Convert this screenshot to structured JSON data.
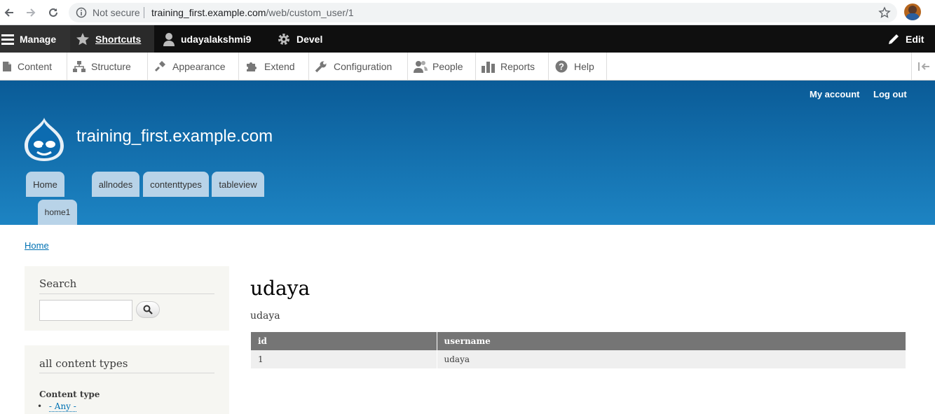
{
  "browser": {
    "security_label": "Not secure",
    "url_host": "training_first.example.com",
    "url_path": "/web/custom_user/1"
  },
  "toolbar": {
    "manage": "Manage",
    "shortcuts": "Shortcuts",
    "user": "udayalakshmi9",
    "devel": "Devel",
    "edit": "Edit"
  },
  "tray": {
    "items": [
      {
        "label": "Content",
        "icon": "file-icon"
      },
      {
        "label": "Structure",
        "icon": "sitemap-icon"
      },
      {
        "label": "Appearance",
        "icon": "paintbrush-icon"
      },
      {
        "label": "Extend",
        "icon": "puzzle-icon"
      },
      {
        "label": "Configuration",
        "icon": "wrench-icon"
      },
      {
        "label": "People",
        "icon": "people-icon"
      },
      {
        "label": "Reports",
        "icon": "bar-chart-icon"
      },
      {
        "label": "Help",
        "icon": "help-icon"
      }
    ]
  },
  "header": {
    "my_account": "My account",
    "log_out": "Log out",
    "site_name": "training_first.example.com",
    "tabs": [
      "Home",
      "allnodes",
      "contenttypes",
      "tableview",
      "home1"
    ]
  },
  "breadcrumb": "Home",
  "sidebar": {
    "search_title": "Search",
    "types_title": "all content types",
    "content_type_label": "Content type",
    "any_option": "- Any -"
  },
  "main": {
    "title": "udaya",
    "text": "udaya",
    "table": {
      "headers": [
        "id",
        "username"
      ],
      "rows": [
        [
          "1",
          "udaya"
        ]
      ]
    }
  },
  "colors": {
    "toolbar_bg": "#0f0f0f",
    "header_top": "#0a5b97",
    "header_bottom": "#1d84c3",
    "tab_bg": "#b8d3e8",
    "link": "#0071b3",
    "table_header": "#757575"
  }
}
